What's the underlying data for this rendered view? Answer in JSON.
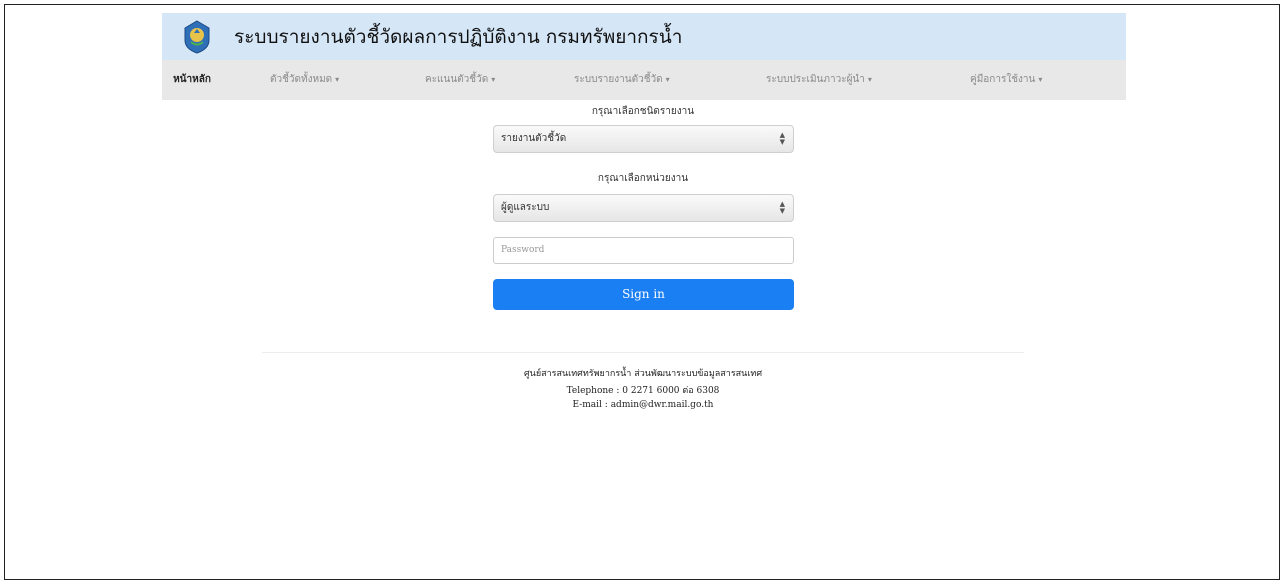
{
  "header": {
    "title": "ระบบรายงานตัวชี้วัดผลการปฏิบัติงาน กรมทรัพยากรน้ำ",
    "logo_icon": "department-emblem-icon"
  },
  "nav": {
    "items": [
      {
        "label": "หน้าหลัก"
      },
      {
        "label": "ตัวชี้วัดทั้งหมด",
        "caret": "▾"
      },
      {
        "label": "คะแนนตัวชี้วัด",
        "caret": "▾"
      },
      {
        "label": "ระบบรายงานตัวชี้วัด",
        "caret": "▾"
      },
      {
        "label": "ระบบประเมินภาวะผู้นำ",
        "caret": "▾"
      },
      {
        "label": "คู่มือการใช้งาน",
        "caret": "▾"
      }
    ]
  },
  "form": {
    "report_type_label": "กรุณาเลือกชนิดรายงาน",
    "report_type_value": "รายงานตัวชี้วัด",
    "unit_label": "กรุณาเลือกหน่วยงาน",
    "unit_value": "ผู้ดูแลระบบ",
    "password_placeholder": "Password",
    "signin_label": "Sign in"
  },
  "footer": {
    "org": "ศูนย์สารสนเทศทรัพยากรน้ำ ส่วนพัฒนาระบบข้อมูลสารสนเทศ",
    "telephone": "Telephone : 0 2271 6000 ต่อ 6308",
    "email": "E-mail : admin@dwr.mail.go.th"
  },
  "colors": {
    "header_bg": "#d5e6f7",
    "nav_bg": "#e8e8e8",
    "primary_button": "#1a7ff2"
  }
}
